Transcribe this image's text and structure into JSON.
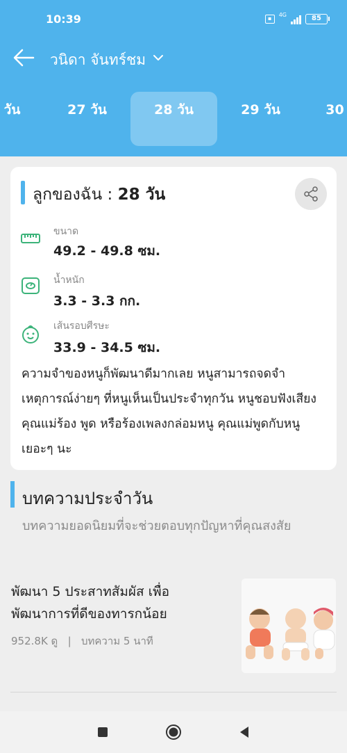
{
  "status_bar": {
    "time": "10:39",
    "network": "4G",
    "battery": "85"
  },
  "topbar": {
    "child_name": "วนิดา จันทร์ชม"
  },
  "day_tabs": [
    {
      "label": "วัน",
      "active": false
    },
    {
      "label": "27 วัน",
      "active": false
    },
    {
      "label": "28 วัน",
      "active": true
    },
    {
      "label": "29 วัน",
      "active": false
    },
    {
      "label": "30",
      "active": false
    }
  ],
  "card": {
    "title_prefix": "ลูกของฉัน :",
    "title_days": "28 วัน",
    "metrics": [
      {
        "label": "ขนาด",
        "value": "49.2 - 49.8 ซม.",
        "icon": "ruler-icon"
      },
      {
        "label": "น้ำหนัก",
        "value": "3.3 - 3.3 กก.",
        "icon": "scale-icon"
      },
      {
        "label": "เส้นรอบศีรษะ",
        "value": "33.9 - 34.5 ซม.",
        "icon": "baby-face-icon"
      }
    ],
    "description": "ความจำของหนูก็พัฒนาดีมากเลย หนูสามารถจดจำเหตุการณ์ง่ายๆ ที่หนูเห็นเป็นประจำทุกวัน หนูชอบฟังเสียงคุณแม่ร้อง พูด หรือร้องเพลงกล่อมหนู คุณแม่พูดกับหนูเยอะๆ นะ",
    "accent_color": "#4fb3ec",
    "icon_color": "#3cb37a"
  },
  "section": {
    "title": "บทความประจำวัน",
    "subtitle": "บทความยอดนิยมที่จะช่วยตอบทุกปัญหาที่คุณสงสัย"
  },
  "article": {
    "title": "พัฒนา 5 ประสาทสัมผัส เพื่อพัฒนาการที่ดีของทารกน้อย",
    "views": "952.8K ดู",
    "separator": "|",
    "read_time": "บทความ 5 นาที",
    "thumbnail": "babies-photo"
  },
  "colors": {
    "header": "#4fb3ec",
    "background": "#eeeeee"
  }
}
